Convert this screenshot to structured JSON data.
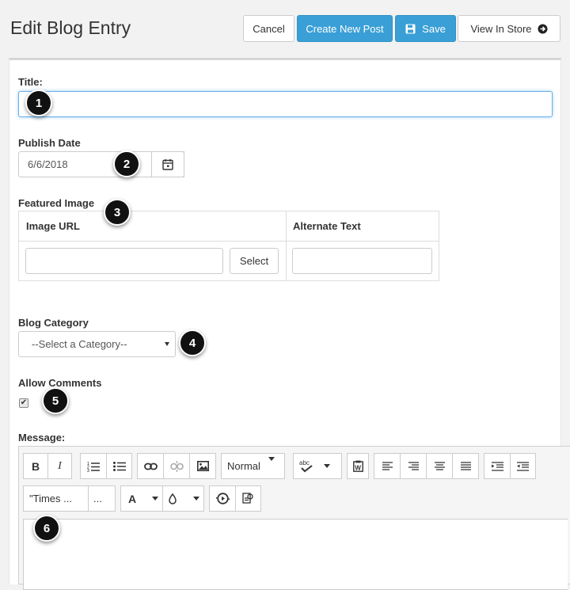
{
  "header": {
    "title": "Edit Blog Entry",
    "cancel_label": "Cancel",
    "create_label": "Create New Post",
    "save_label": "Save",
    "view_label": "View In Store"
  },
  "form": {
    "title_label": "Title:",
    "title_value": "",
    "publish_label": "Publish Date",
    "publish_value": "6/6/2018",
    "featured_label": "Featured Image",
    "image_url_header": "Image URL",
    "alt_text_header": "Alternate Text",
    "select_label": "Select",
    "image_url_value": "",
    "alt_text_value": "",
    "category_label": "Blog Category",
    "category_value": "--Select a Category--",
    "comments_label": "Allow Comments",
    "comments_checked": true,
    "message_label": "Message:"
  },
  "editor": {
    "bold": "B",
    "italic": "I",
    "format_value": "Normal",
    "font_value": "\"Times ...",
    "size_value": "...",
    "font_color": "A"
  },
  "badges": [
    "1",
    "2",
    "3",
    "4",
    "5",
    "6"
  ],
  "colors": {
    "primary": "#3a9fd6",
    "focus": "#66afe9"
  }
}
